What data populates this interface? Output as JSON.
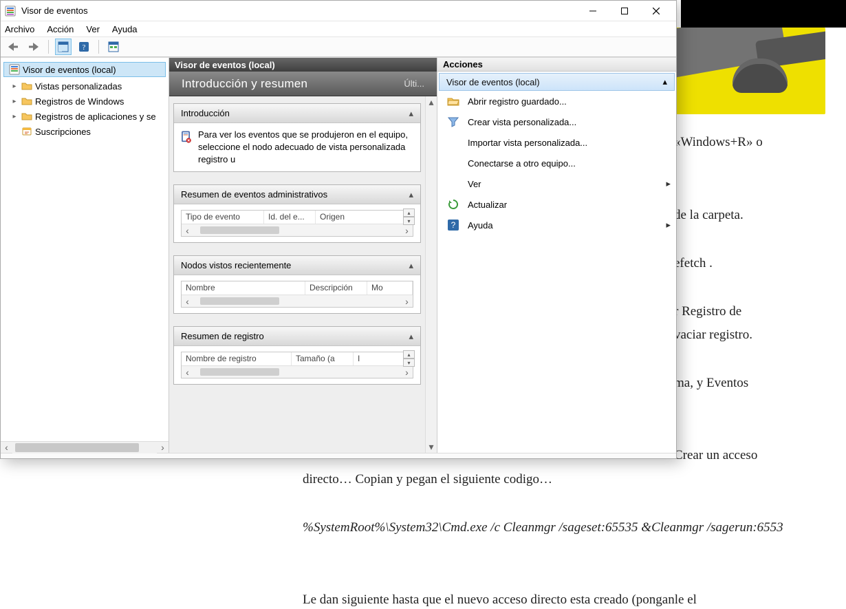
{
  "window": {
    "title": "Visor de eventos"
  },
  "menu": {
    "archivo": "Archivo",
    "accion": "Acción",
    "ver": "Ver",
    "ayuda": "Ayuda"
  },
  "tree": {
    "root": "Visor de eventos (local)",
    "items": [
      "Vistas personalizadas",
      "Registros de Windows",
      "Registros de aplicaciones y se",
      "Suscripciones"
    ]
  },
  "center": {
    "title": "Visor de eventos (local)",
    "heading": "Introducción y resumen",
    "heading_right": "Últi...",
    "intro_header": "Introducción",
    "intro_text": "Para ver los eventos que se produjeron en el equipo, seleccione el nodo adecuado de vista personalizada  registro u",
    "admin_summary_header": "Resumen de eventos administrativos",
    "admin_cols": [
      "Tipo de evento",
      "Id. del e...",
      "Origen"
    ],
    "recent_header": "Nodos vistos recientemente",
    "recent_cols": [
      "Nombre",
      "Descripción",
      "Mo"
    ],
    "log_summary_header": "Resumen de registro",
    "log_cols": [
      "Nombre de registro",
      "Tamaño (a",
      "I"
    ]
  },
  "actions": {
    "title": "Acciones",
    "group": "Visor de eventos (local)",
    "items": {
      "open_saved": "Abrir registro guardado...",
      "create_view": "Crear vista personalizada...",
      "import_view": "Importar vista personalizada...",
      "connect": "Conectarse a otro equipo...",
      "ver": "Ver",
      "refresh": "Actualizar",
      "help": "Ayuda"
    }
  },
  "article": {
    "p1": "«Windows+R» o",
    "p2": "de la carpeta.",
    "p3": "efetch .",
    "p4a": "r Registro de",
    "p4b": "vaciar registro.",
    "p5": "ma, y Eventos",
    "p6a": "Crear un acceso",
    "p6b": "directo… Copian y pegan el siguiente codigo…",
    "p7": "%SystemRoot%\\System32\\Cmd.exe /c Cleanmgr /sageset:65535 &Cleanmgr /sagerun:6553",
    "p8": "Le dan siguiente hasta que el nuevo acceso directo esta creado (ponganle el"
  }
}
